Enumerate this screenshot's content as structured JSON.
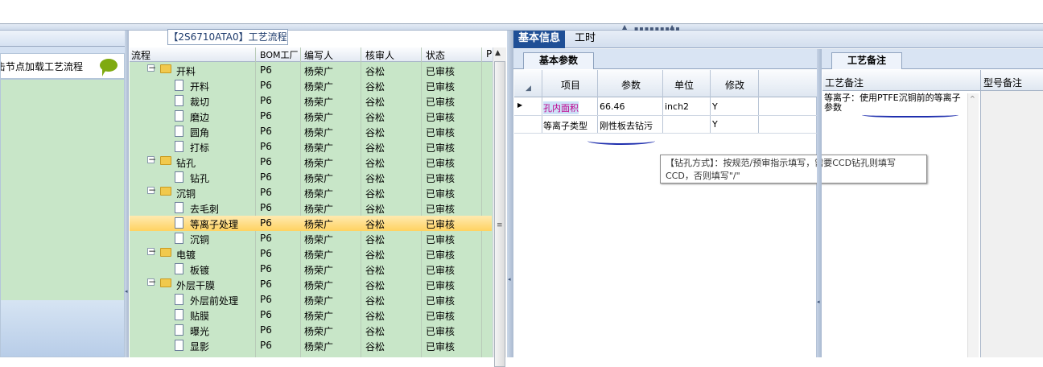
{
  "left_panel": {
    "item_text": "击节点加载工艺流程"
  },
  "middle": {
    "title": "【2S6710ATA0】工艺流程",
    "columns": [
      "流程",
      "BOM工厂",
      "编写人",
      "核审人",
      "状态",
      "P"
    ],
    "rows": [
      {
        "name": "开料",
        "level": 0,
        "bom": "P6",
        "writer": "杨荣广",
        "reviewer": "谷松",
        "status": "已审核"
      },
      {
        "name": "开料",
        "level": 1,
        "bom": "P6",
        "writer": "杨荣广",
        "reviewer": "谷松",
        "status": "已审核"
      },
      {
        "name": "裁切",
        "level": 1,
        "bom": "P6",
        "writer": "杨荣广",
        "reviewer": "谷松",
        "status": "已审核"
      },
      {
        "name": "磨边",
        "level": 1,
        "bom": "P6",
        "writer": "杨荣广",
        "reviewer": "谷松",
        "status": "已审核"
      },
      {
        "name": "圆角",
        "level": 1,
        "bom": "P6",
        "writer": "杨荣广",
        "reviewer": "谷松",
        "status": "已审核"
      },
      {
        "name": "打标",
        "level": 1,
        "bom": "P6",
        "writer": "杨荣广",
        "reviewer": "谷松",
        "status": "已审核"
      },
      {
        "name": "钻孔",
        "level": 0,
        "bom": "P6",
        "writer": "杨荣广",
        "reviewer": "谷松",
        "status": "已审核"
      },
      {
        "name": "钻孔",
        "level": 1,
        "bom": "P6",
        "writer": "杨荣广",
        "reviewer": "谷松",
        "status": "已审核"
      },
      {
        "name": "沉铜",
        "level": 0,
        "bom": "P6",
        "writer": "杨荣广",
        "reviewer": "谷松",
        "status": "已审核"
      },
      {
        "name": "去毛刺",
        "level": 1,
        "bom": "P6",
        "writer": "杨荣广",
        "reviewer": "谷松",
        "status": "已审核"
      },
      {
        "name": "等离子处理",
        "level": 1,
        "bom": "P6",
        "writer": "杨荣广",
        "reviewer": "谷松",
        "status": "已审核",
        "selected": true
      },
      {
        "name": "沉铜",
        "level": 1,
        "bom": "P6",
        "writer": "杨荣广",
        "reviewer": "谷松",
        "status": "已审核"
      },
      {
        "name": "电镀",
        "level": 0,
        "bom": "P6",
        "writer": "杨荣广",
        "reviewer": "谷松",
        "status": "已审核"
      },
      {
        "name": "板镀",
        "level": 1,
        "bom": "P6",
        "writer": "杨荣广",
        "reviewer": "谷松",
        "status": "已审核"
      },
      {
        "name": "外层干膜",
        "level": 0,
        "bom": "P6",
        "writer": "杨荣广",
        "reviewer": "谷松",
        "status": "已审核"
      },
      {
        "name": "外层前处理",
        "level": 1,
        "bom": "P6",
        "writer": "杨荣广",
        "reviewer": "谷松",
        "status": "已审核"
      },
      {
        "name": "贴膜",
        "level": 1,
        "bom": "P6",
        "writer": "杨荣广",
        "reviewer": "谷松",
        "status": "已审核"
      },
      {
        "name": "曝光",
        "level": 1,
        "bom": "P6",
        "writer": "杨荣广",
        "reviewer": "谷松",
        "status": "已审核"
      },
      {
        "name": "显影",
        "level": 1,
        "bom": "P6",
        "writer": "杨荣广",
        "reviewer": "谷松",
        "status": "已审核"
      }
    ]
  },
  "right": {
    "tabs": [
      "基本信息",
      "工时"
    ],
    "subtab": "基本参数",
    "param_columns": [
      "项目",
      "参数",
      "单位",
      "修改"
    ],
    "params": [
      {
        "item": "孔内面积",
        "value": "66.46",
        "unit": "inch2",
        "modify": "Y"
      },
      {
        "item": "等离子类型",
        "value": "刚性板去钻污",
        "unit": "",
        "modify": "Y"
      }
    ],
    "tooltip": "【钻孔方式】：按规范/预审指示填写，需要CCD钻孔则填写CCD，否则填写\"/\""
  },
  "notes": {
    "tab": "工艺备注",
    "col1": "工艺备注",
    "col2": "型号备注",
    "text": "等离子：使用PTFE沉铜前的等离子参数"
  },
  "colors": {
    "tree_bg": "#c8e6c8",
    "selected_row": "#ffd261",
    "active_tab": "#1f4f96",
    "highlight_text": "#c0008c"
  }
}
